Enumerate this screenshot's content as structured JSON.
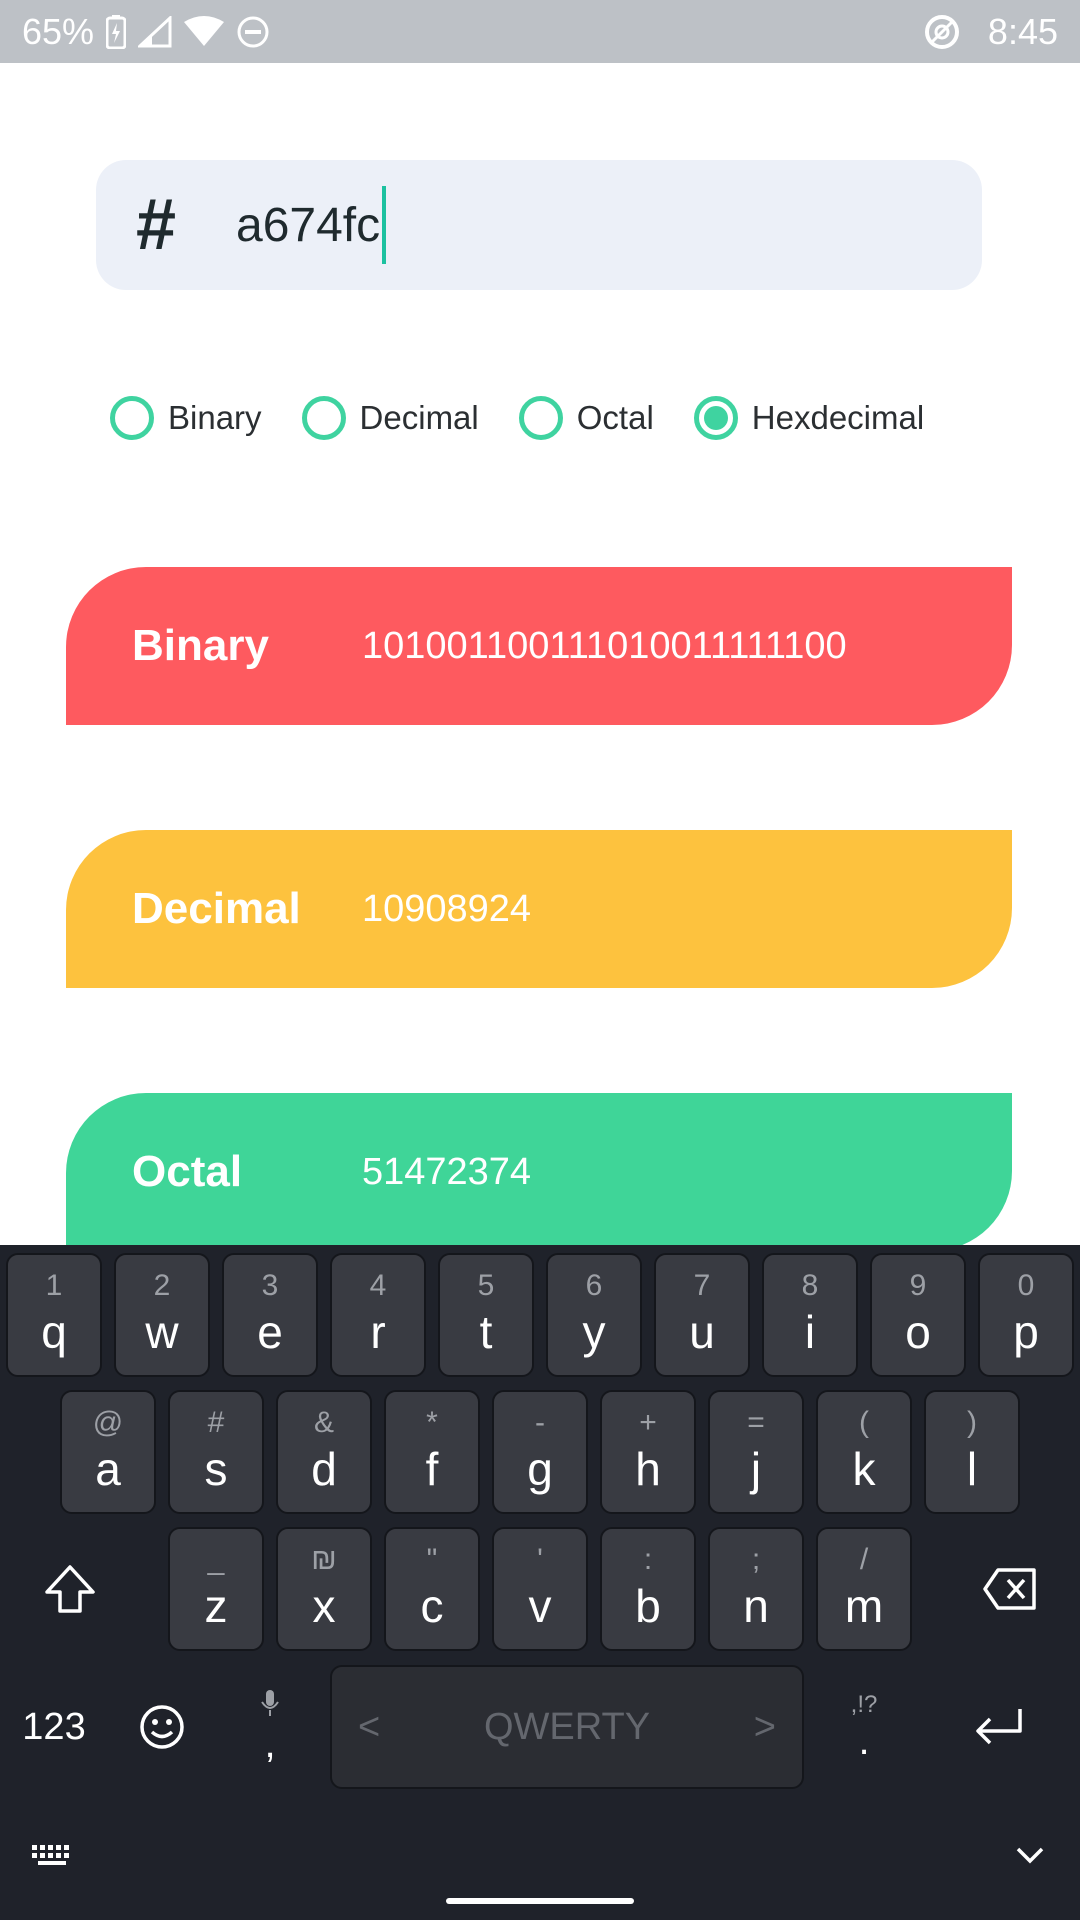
{
  "status_bar": {
    "battery": "65%",
    "time": "8:45"
  },
  "input": {
    "prefix": "#",
    "value": "a674fc"
  },
  "radios": [
    {
      "label": "Binary",
      "selected": false
    },
    {
      "label": "Decimal",
      "selected": false
    },
    {
      "label": "Octal",
      "selected": false
    },
    {
      "label": "Hexdecimal",
      "selected": true
    }
  ],
  "results": [
    {
      "label": "Binary",
      "value": "101001100111010011111100",
      "color": "#fe5a5f"
    },
    {
      "label": "Decimal",
      "value": "10908924",
      "color": "#fdc23e"
    },
    {
      "label": "Octal",
      "value": "51472374",
      "color": "#3fd598"
    }
  ],
  "colors": {
    "accent": "#3fd3a0",
    "caret": "#1cc1a0",
    "input_bg": "#ecf0f8"
  },
  "keyboard": {
    "row1": [
      {
        "alt": "1",
        "key": "q"
      },
      {
        "alt": "2",
        "key": "w"
      },
      {
        "alt": "3",
        "key": "e"
      },
      {
        "alt": "4",
        "key": "r"
      },
      {
        "alt": "5",
        "key": "t"
      },
      {
        "alt": "6",
        "key": "y"
      },
      {
        "alt": "7",
        "key": "u"
      },
      {
        "alt": "8",
        "key": "i"
      },
      {
        "alt": "9",
        "key": "o"
      },
      {
        "alt": "0",
        "key": "p"
      }
    ],
    "row2": [
      {
        "alt": "@",
        "key": "a"
      },
      {
        "alt": "#",
        "key": "s"
      },
      {
        "alt": "&",
        "key": "d"
      },
      {
        "alt": "*",
        "key": "f"
      },
      {
        "alt": "-",
        "key": "g"
      },
      {
        "alt": "+",
        "key": "h"
      },
      {
        "alt": "=",
        "key": "j"
      },
      {
        "alt": "(",
        "key": "k"
      },
      {
        "alt": ")",
        "key": "l"
      }
    ],
    "row3": [
      {
        "alt": "_",
        "key": "z"
      },
      {
        "alt": "₪",
        "key": "x"
      },
      {
        "alt": "\"",
        "key": "c"
      },
      {
        "alt": "'",
        "key": "v"
      },
      {
        "alt": ":",
        "key": "b"
      },
      {
        "alt": ";",
        "key": "n"
      },
      {
        "alt": "/",
        "key": "m"
      }
    ],
    "numbers_label": "123",
    "comma": ",",
    "space_label": "QWERTY",
    "period": ".",
    "period_alt": ",!?"
  }
}
